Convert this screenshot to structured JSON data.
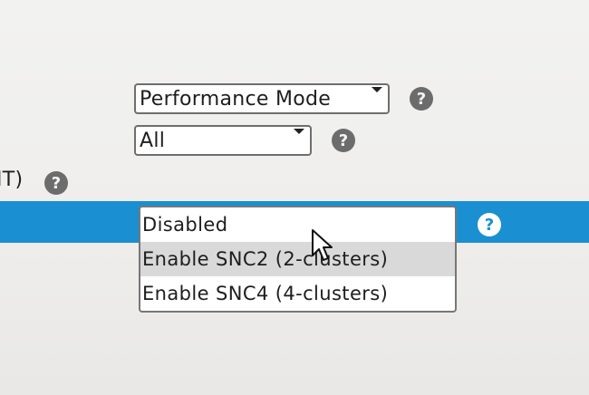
{
  "settings": {
    "mode_select": {
      "value": "Performance Mode"
    },
    "scope_select": {
      "value": "All"
    },
    "row_label": "IT)",
    "snc": {
      "options": [
        "Disabled",
        "Enable SNC2 (2-clusters)",
        "Enable SNC4 (4-clusters)"
      ],
      "hovered_index": 1
    },
    "help_glyph": "?"
  },
  "colors": {
    "highlight": "#1a8fd2",
    "help_icon": "#6c6c6c"
  }
}
